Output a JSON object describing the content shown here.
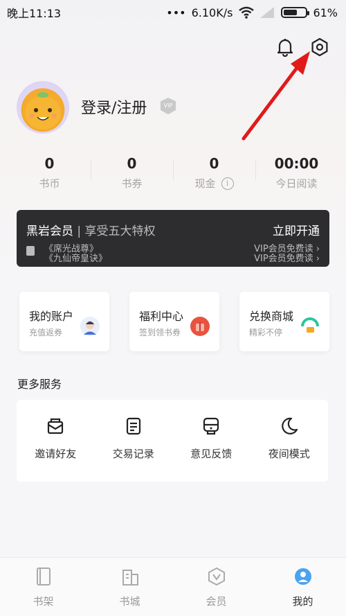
{
  "status_bar": {
    "time": "晚上11:13",
    "network_speed": "6.10K/s",
    "battery": "61%"
  },
  "header": {
    "bell_icon": "bell-icon",
    "settings_icon": "gear-icon"
  },
  "profile": {
    "login_text": "登录/注册",
    "vip_badge": "VIP"
  },
  "stats": [
    {
      "value": "0",
      "label": "书币"
    },
    {
      "value": "0",
      "label": "书券"
    },
    {
      "value": "0",
      "label": "现金"
    },
    {
      "value": "00:00",
      "label": "今日阅读"
    }
  ],
  "vip_card": {
    "title": "黑岩会员",
    "subtitle": "| 享受五大特权",
    "action": "立即开通",
    "ticker_left_1": "《席光战尊》",
    "ticker_left_2": "《九仙帝皇诀》",
    "ticker_right_1": "VIP会员免费读 ›",
    "ticker_right_2": "VIP会员免费读 ›"
  },
  "cards": [
    {
      "title": "我的账户",
      "subtitle": "充值返券",
      "icon": "user-avatar-icon",
      "color": "#e9eefc"
    },
    {
      "title": "福利中心",
      "subtitle": "签到领书券",
      "icon": "gift-icon",
      "color": "#e8533f"
    },
    {
      "title": "兑换商城",
      "subtitle": "精彩不停",
      "icon": "shop-icon",
      "color": "#2ec4a0"
    }
  ],
  "more_services": {
    "title": "更多服务",
    "items": [
      {
        "label": "邀请好友",
        "icon": "invite-envelope-icon"
      },
      {
        "label": "交易记录",
        "icon": "record-list-icon"
      },
      {
        "label": "意见反馈",
        "icon": "feedback-icon"
      },
      {
        "label": "夜间模式",
        "icon": "moon-icon"
      }
    ]
  },
  "tabbar": {
    "items": [
      {
        "label": "书架",
        "icon": "bookshelf-icon"
      },
      {
        "label": "书城",
        "icon": "bookstore-icon"
      },
      {
        "label": "会员",
        "icon": "member-icon"
      },
      {
        "label": "我的",
        "icon": "profile-icon"
      }
    ],
    "active_color": "#4aa3f0"
  }
}
